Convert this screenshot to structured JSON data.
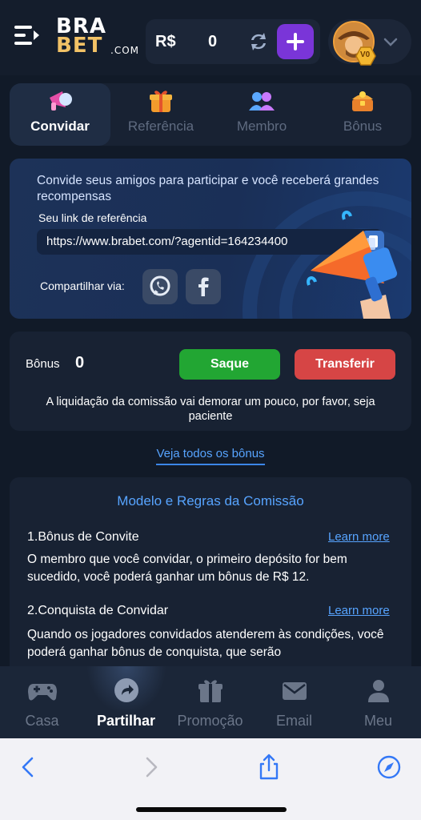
{
  "header": {
    "logo_line1": "BRA",
    "logo_line2": "BET",
    "logo_suffix": ".COM",
    "currency": "R$",
    "balance": "0",
    "vip_badge": "V0",
    "icons": [
      "menu-icon",
      "refresh-icon",
      "plus-icon",
      "avatar",
      "chevron-down-icon"
    ]
  },
  "tabs": [
    {
      "label": "Convidar",
      "icon": "megaphone-icon",
      "active": true
    },
    {
      "label": "Referência",
      "icon": "gift-icon",
      "active": false
    },
    {
      "label": "Membro",
      "icon": "members-icon",
      "active": false
    },
    {
      "label": "Bônus",
      "icon": "treasure-icon",
      "active": false
    }
  ],
  "invite": {
    "message": "Convide seus amigos para participar e você receberá grandes recompensas",
    "link_label": "Seu link de referência",
    "link_url": "https://www.brabet.com/?agentid=164234400",
    "share_label": "Compartilhar via:",
    "share_icons": [
      "whatsapp-icon",
      "facebook-icon"
    ]
  },
  "bonus": {
    "label": "Bônus",
    "value": "0",
    "withdraw_label": "Saque",
    "transfer_label": "Transferir",
    "note": "A liquidação da comissão vai demorar um pouco, por favor, seja paciente"
  },
  "see_all": "Veja todos os bônus",
  "rules": {
    "title": "Modelo e Regras da Comissão",
    "sections": [
      {
        "title": "1.Bônus de Convite",
        "learn_more": "Learn more",
        "body": "O membro que você convidar, o primeiro depósito for bem sucedido, você poderá ganhar um bônus de R$ 12."
      },
      {
        "title": "2.Conquista de Convidar",
        "learn_more": "Learn more",
        "body": "Quando os jogadores convidados atenderem às condições, você poderá ganhar bônus de conquista, que serão"
      }
    ]
  },
  "bottom_nav": [
    {
      "label": "Casa",
      "icon": "gamepad-icon",
      "active": false
    },
    {
      "label": "Partilhar",
      "icon": "share-icon",
      "active": true
    },
    {
      "label": "Promoção",
      "icon": "gift-icon",
      "active": false
    },
    {
      "label": "Email",
      "icon": "mail-icon",
      "active": false
    },
    {
      "label": "Meu",
      "icon": "user-icon",
      "active": false
    }
  ],
  "browser": {
    "icons": [
      "back-icon",
      "forward-icon",
      "share-sheet-icon",
      "compass-icon"
    ],
    "accent": "#3478f6"
  },
  "colors": {
    "background": "#111a28",
    "card": "#182233",
    "accent_blue": "#57a4ff",
    "withdraw_green": "#22a633",
    "transfer_red": "#d64545",
    "plus_purple": "#7a35d8",
    "logo_gold": "#f2c266"
  }
}
